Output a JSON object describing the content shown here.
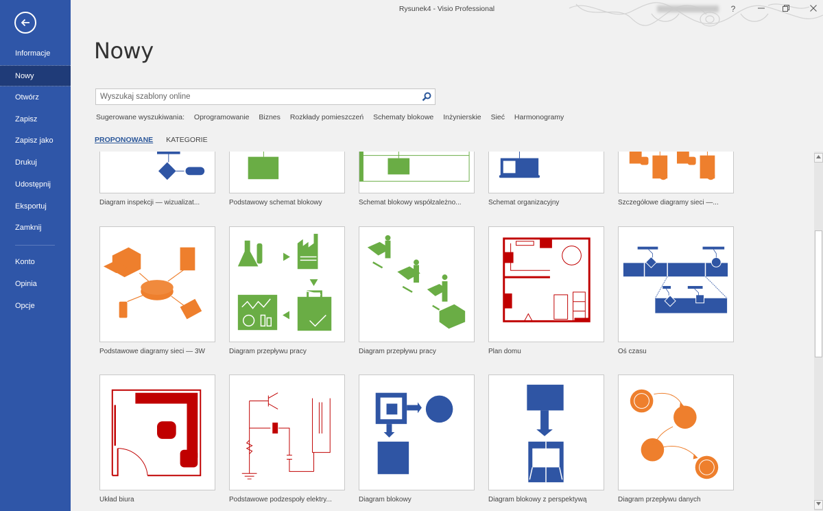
{
  "window": {
    "title": "Rysunek4  -  Visio Professional",
    "user_name_blurred": "",
    "help_label": "?",
    "minimize_label": "—",
    "restore_label": "❐",
    "close_label": "✕"
  },
  "sidebar": {
    "back_icon": "arrow-left-circle-icon",
    "items": [
      {
        "label": "Informacje",
        "active": false
      },
      {
        "label": "Nowy",
        "active": true
      },
      {
        "label": "Otwórz",
        "active": false
      },
      {
        "label": "Zapisz",
        "active": false
      },
      {
        "label": "Zapisz jako",
        "active": false
      },
      {
        "label": "Drukuj",
        "active": false
      },
      {
        "label": "Udostępnij",
        "active": false
      },
      {
        "label": "Eksportuj",
        "active": false
      },
      {
        "label": "Zamknij",
        "active": false
      },
      {
        "label": "Konto",
        "active": false
      },
      {
        "label": "Opinia",
        "active": false
      },
      {
        "label": "Opcje",
        "active": false
      }
    ]
  },
  "main": {
    "title": "Nowy",
    "search": {
      "placeholder": "Wyszukaj szablony online",
      "value": "",
      "icon": "search-icon"
    },
    "suggested": {
      "label": "Sugerowane wyszukiwania:",
      "links": [
        "Oprogramowanie",
        "Biznes",
        "Rozkłady pomieszczeń",
        "Schematy blokowe",
        "Inżynierskie",
        "Sieć",
        "Harmonogramy"
      ]
    },
    "tabs": [
      {
        "label": "PROPONOWANE",
        "active": true
      },
      {
        "label": "KATEGORIE",
        "active": false
      }
    ],
    "templates": [
      {
        "label": "Diagram inspekcji — wizualizat...",
        "thumb": "flowchart-blue",
        "color": "#2f55a4"
      },
      {
        "label": "Podstawowy schemat blokowy",
        "thumb": "basic-flowchart-green",
        "color": "#6aad45"
      },
      {
        "label": "Schemat blokowy współzależno...",
        "thumb": "cross-functional-green",
        "color": "#6aad45"
      },
      {
        "label": "Schemat organizacyjny",
        "thumb": "org-chart-blue",
        "color": "#2f55a4"
      },
      {
        "label": "Szczegółowe diagramy sieci —...",
        "thumb": "detailed-network-orange",
        "color": "#ee7f2d"
      },
      {
        "label": "Podstawowe diagramy sieci — 3W",
        "thumb": "basic-network-orange",
        "color": "#ee7f2d"
      },
      {
        "label": "Diagram przepływu pracy",
        "thumb": "workflow-icons-green",
        "color": "#6aad45"
      },
      {
        "label": "Diagram przepływu pracy",
        "thumb": "workflow-3d-green",
        "color": "#6aad45"
      },
      {
        "label": "Plan domu",
        "thumb": "home-plan-red",
        "color": "#c00000"
      },
      {
        "label": "Oś czasu",
        "thumb": "timeline-blue",
        "color": "#2f55a4"
      },
      {
        "label": "Układ biura",
        "thumb": "office-layout-red",
        "color": "#c00000"
      },
      {
        "label": "Podstawowe podzespoły elektry...",
        "thumb": "electrical-red",
        "color": "#c00000"
      },
      {
        "label": "Diagram blokowy",
        "thumb": "block-diagram-blue",
        "color": "#2f55a4"
      },
      {
        "label": "Diagram blokowy z perspektywą",
        "thumb": "block-perspective-blue",
        "color": "#2f55a4"
      },
      {
        "label": "Diagram przepływu danych",
        "thumb": "data-flow-orange",
        "color": "#ee7f2d"
      }
    ]
  },
  "scrollbar": {
    "position_fraction": 0.32,
    "visible_fraction": 0.38
  }
}
